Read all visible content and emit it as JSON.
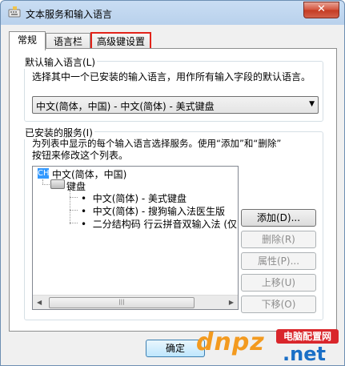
{
  "window": {
    "title": "文本服务和输入语言",
    "close_label": "✕"
  },
  "tabs": [
    {
      "label": "常规",
      "active": true
    },
    {
      "label": "语言栏",
      "active": false
    },
    {
      "label": "高级键设置",
      "active": false,
      "highlighted": true
    }
  ],
  "default_language": {
    "group_label": "默认输入语言(L)",
    "description": "选择其中一个已安装的输入语言，用作所有输入字段的默认语言。",
    "selected_value": "中文(简体，中国) - 中文(简体) - 美式键盘"
  },
  "installed_services": {
    "group_label": "已安装的服务(I)",
    "description_line1": "为列表中显示的每个输入语言选择服务。使用“添加”和“删除”",
    "description_line2": "按钮来修改这个列表。",
    "tree": {
      "language_badge": "CH",
      "language": "中文(简体，中国)",
      "category": "键盘",
      "items": [
        "中文(简体) - 美式键盘",
        "中文(简体) - 搜狗输入法医生版",
        "二分结构码 行云拼音双输入法 (仅"
      ]
    },
    "scrollbar": {
      "left_arrow": "◀",
      "thumb_grip": "|||",
      "right_arrow": "▶"
    },
    "buttons": {
      "add": "添加(D)...",
      "remove": "删除(R)",
      "properties": "属性(P)...",
      "move_up": "上移(U)",
      "move_down": "下移(O)"
    }
  },
  "footer": {
    "ok": "确定"
  },
  "watermark": {
    "brand_text": "dnpz",
    "badge_text": "电脑配置网",
    "suffix": ".net"
  },
  "colors": {
    "highlight": "#e2231a",
    "selection": "#3399ff"
  }
}
